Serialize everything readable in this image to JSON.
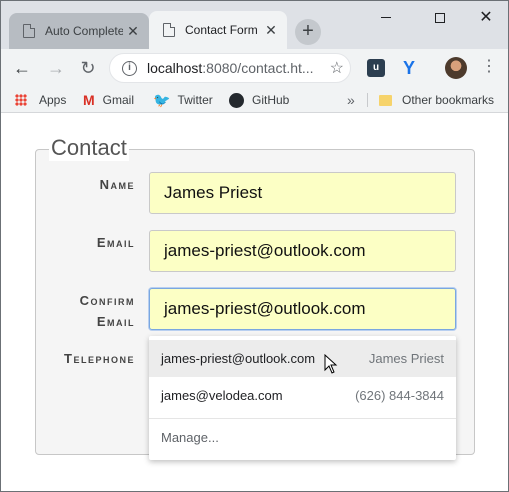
{
  "browser": {
    "tabs": [
      {
        "title": "Auto Complete",
        "active": false,
        "close": "✕"
      },
      {
        "title": "Contact Form",
        "active": true,
        "close": "✕"
      }
    ],
    "new_tab": "+",
    "window_controls": {
      "close": "✕"
    },
    "nav": {
      "back": "←",
      "forward": "→",
      "reload": "↻"
    },
    "address": {
      "host": "localhost",
      "rest": ":8080/contact.ht..."
    },
    "star": "☆",
    "ext2": "Y",
    "kebab": "⋮",
    "bookmarks": [
      {
        "label": "Apps",
        "icon": "apps-grid-icon"
      },
      {
        "label": "Gmail",
        "icon": "gmail-icon"
      },
      {
        "label": "Twitter",
        "icon": "twitter-bird-icon"
      },
      {
        "label": "GitHub",
        "icon": "github-icon"
      }
    ],
    "bookmarks_more": "»",
    "other_bookmarks": "Other bookmarks"
  },
  "form": {
    "legend": "Contact",
    "fields": [
      {
        "label": "Name",
        "value": "James Priest"
      },
      {
        "label": "Email",
        "value": "james-priest@outlook.com"
      },
      {
        "label_line1": "Confirm",
        "label_line2": "Email",
        "value": "james-priest@outlook.com"
      },
      {
        "label": "Telephone"
      }
    ]
  },
  "autocomplete": {
    "suggestions": [
      {
        "value": "james-priest@outlook.com",
        "detail": "James Priest"
      },
      {
        "value": "james@velodea.com",
        "detail": "(626) 844-3844"
      }
    ],
    "manage": "Manage..."
  },
  "colors": {
    "autofill_bg": "#fcffc5",
    "focus_border": "#7aa7e0"
  }
}
